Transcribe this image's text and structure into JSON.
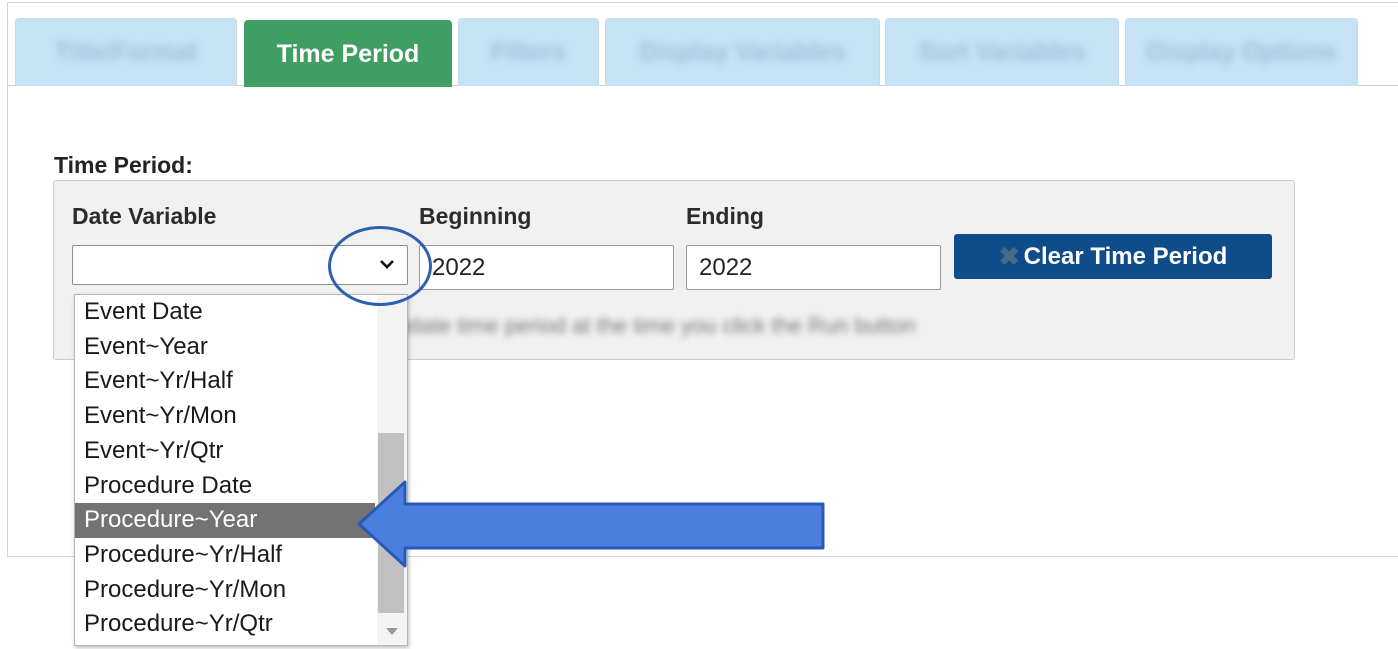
{
  "tabs": [
    {
      "label": "Title/Format",
      "active": false
    },
    {
      "label": "Time Period",
      "active": true
    },
    {
      "label": "Filters",
      "active": false
    },
    {
      "label": "Display Variables",
      "active": false
    },
    {
      "label": "Sort Variables",
      "active": false
    },
    {
      "label": "Display Options",
      "active": false
    }
  ],
  "time_period": {
    "section_label": "Time Period:",
    "date_variable_label": "Date Variable",
    "date_variable_value": "",
    "beginning_label": "Beginning",
    "beginning_value": "2022",
    "ending_label": "Ending",
    "ending_value": "2022",
    "clear_label": "Clear Time Period",
    "note": "Update time period at the time you click the Run button"
  },
  "dropdown": {
    "options": [
      "Event Date",
      "Event~Year",
      "Event~Yr/Half",
      "Event~Yr/Mon",
      "Event~Yr/Qtr",
      "Procedure Date",
      "Procedure~Year",
      "Procedure~Yr/Half",
      "Procedure~Yr/Mon",
      "Procedure~Yr/Qtr"
    ],
    "highlighted_option": "Procedure~Year"
  },
  "colors": {
    "active_tab": "#3f9e63",
    "inactive_tab": "#c6e2f5",
    "clear_button": "#0f4c8a",
    "annotation": "#4a7fe0"
  },
  "icons": {
    "select_arrow": "chevron-down-icon",
    "clear": "x-icon"
  }
}
